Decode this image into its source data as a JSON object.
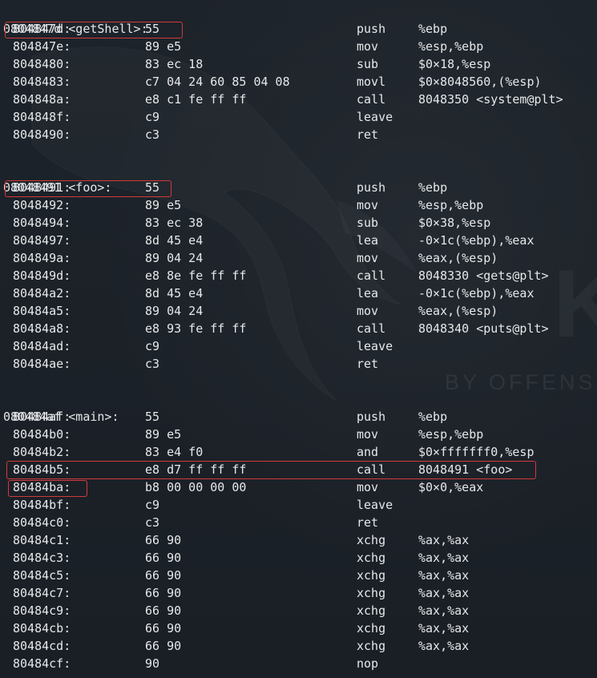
{
  "theme": {
    "background": "#1c2128",
    "text": "#e6e8ea",
    "highlight_border": "#d23a3a"
  },
  "watermark": {
    "text": "BY OFFENS",
    "letter": "K"
  },
  "functions": [
    {
      "header": "0804847d <getShell>:",
      "rows": [
        {
          "addr": "804847d:",
          "bytes": "55",
          "mnem": "push",
          "ops": "%ebp"
        },
        {
          "addr": "804847e:",
          "bytes": "89 e5",
          "mnem": "mov",
          "ops": "%esp,%ebp"
        },
        {
          "addr": "8048480:",
          "bytes": "83 ec 18",
          "mnem": "sub",
          "ops": "$0×18,%esp"
        },
        {
          "addr": "8048483:",
          "bytes": "c7 04 24 60 85 04 08",
          "mnem": "movl",
          "ops": "$0×8048560,(%esp)"
        },
        {
          "addr": "804848a:",
          "bytes": "e8 c1 fe ff ff",
          "mnem": "call",
          "ops": "8048350 <system@plt>"
        },
        {
          "addr": "804848f:",
          "bytes": "c9",
          "mnem": "leave",
          "ops": ""
        },
        {
          "addr": "8048490:",
          "bytes": "c3",
          "mnem": "ret",
          "ops": ""
        }
      ]
    },
    {
      "header": "08048491 <foo>:",
      "rows": [
        {
          "addr": "8048491:",
          "bytes": "55",
          "mnem": "push",
          "ops": "%ebp"
        },
        {
          "addr": "8048492:",
          "bytes": "89 e5",
          "mnem": "mov",
          "ops": "%esp,%ebp"
        },
        {
          "addr": "8048494:",
          "bytes": "83 ec 38",
          "mnem": "sub",
          "ops": "$0×38,%esp"
        },
        {
          "addr": "8048497:",
          "bytes": "8d 45 e4",
          "mnem": "lea",
          "ops": "-0×1c(%ebp),%eax"
        },
        {
          "addr": "804849a:",
          "bytes": "89 04 24",
          "mnem": "mov",
          "ops": "%eax,(%esp)"
        },
        {
          "addr": "804849d:",
          "bytes": "e8 8e fe ff ff",
          "mnem": "call",
          "ops": "8048330 <gets@plt>"
        },
        {
          "addr": "80484a2:",
          "bytes": "8d 45 e4",
          "mnem": "lea",
          "ops": "-0×1c(%ebp),%eax"
        },
        {
          "addr": "80484a5:",
          "bytes": "89 04 24",
          "mnem": "mov",
          "ops": "%eax,(%esp)"
        },
        {
          "addr": "80484a8:",
          "bytes": "e8 93 fe ff ff",
          "mnem": "call",
          "ops": "8048340 <puts@plt>"
        },
        {
          "addr": "80484ad:",
          "bytes": "c9",
          "mnem": "leave",
          "ops": ""
        },
        {
          "addr": "80484ae:",
          "bytes": "c3",
          "mnem": "ret",
          "ops": ""
        }
      ]
    },
    {
      "header": "080484af <main>:",
      "rows": [
        {
          "addr": "80484af:",
          "bytes": "55",
          "mnem": "push",
          "ops": "%ebp"
        },
        {
          "addr": "80484b0:",
          "bytes": "89 e5",
          "mnem": "mov",
          "ops": "%esp,%ebp"
        },
        {
          "addr": "80484b2:",
          "bytes": "83 e4 f0",
          "mnem": "and",
          "ops": "$0×fffffff0,%esp"
        },
        {
          "addr": "80484b5:",
          "bytes": "e8 d7 ff ff ff",
          "mnem": "call",
          "ops": "8048491 <foo>"
        },
        {
          "addr": "80484ba:",
          "bytes": "b8 00 00 00 00",
          "mnem": "mov",
          "ops": "$0×0,%eax"
        },
        {
          "addr": "80484bf:",
          "bytes": "c9",
          "mnem": "leave",
          "ops": ""
        },
        {
          "addr": "80484c0:",
          "bytes": "c3",
          "mnem": "ret",
          "ops": ""
        },
        {
          "addr": "80484c1:",
          "bytes": "66 90",
          "mnem": "xchg",
          "ops": "%ax,%ax"
        },
        {
          "addr": "80484c3:",
          "bytes": "66 90",
          "mnem": "xchg",
          "ops": "%ax,%ax"
        },
        {
          "addr": "80484c5:",
          "bytes": "66 90",
          "mnem": "xchg",
          "ops": "%ax,%ax"
        },
        {
          "addr": "80484c7:",
          "bytes": "66 90",
          "mnem": "xchg",
          "ops": "%ax,%ax"
        },
        {
          "addr": "80484c9:",
          "bytes": "66 90",
          "mnem": "xchg",
          "ops": "%ax,%ax"
        },
        {
          "addr": "80484cb:",
          "bytes": "66 90",
          "mnem": "xchg",
          "ops": "%ax,%ax"
        },
        {
          "addr": "80484cd:",
          "bytes": "66 90",
          "mnem": "xchg",
          "ops": "%ax,%ax"
        },
        {
          "addr": "80484cf:",
          "bytes": "90",
          "mnem": "nop",
          "ops": ""
        }
      ]
    }
  ]
}
